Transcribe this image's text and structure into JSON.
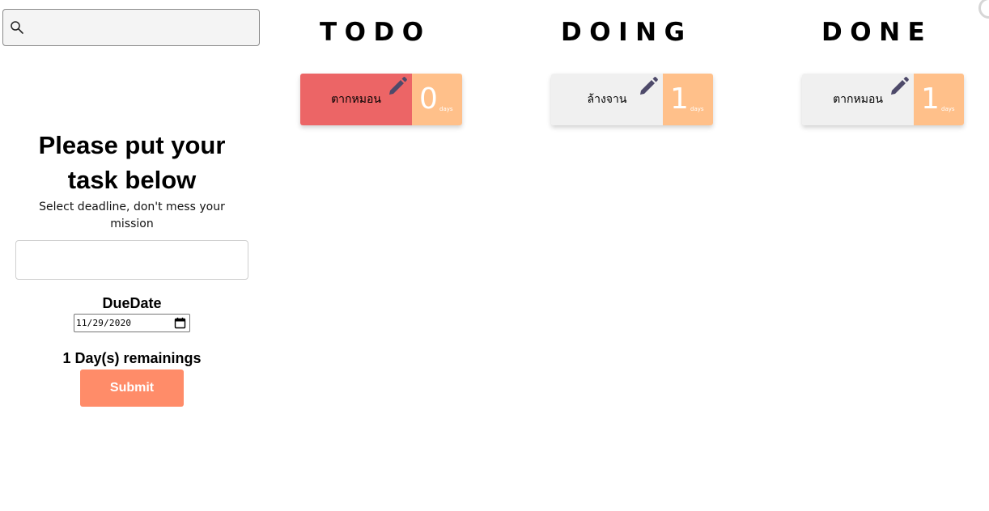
{
  "search": {
    "placeholder": "",
    "value": "",
    "icon": "search-icon"
  },
  "form": {
    "title_line1": "Please put your",
    "title_line2": "task below",
    "subtitle": "Select deadline, don't mess your mission",
    "task_input_value": "",
    "due_label": "DueDate",
    "due_date_display": "11/29/2020",
    "remaining_text": "1 Day(s) remainings",
    "submit_label": "Submit"
  },
  "columns": [
    {
      "title": "TODO",
      "cards": [
        {
          "text": "ตากหมอน",
          "days": "0",
          "unit": "days",
          "status": "overdue"
        }
      ]
    },
    {
      "title": "DOING",
      "cards": [
        {
          "text": "ล้างจาน",
          "days": "1",
          "unit": "days",
          "status": "normal"
        }
      ]
    },
    {
      "title": "DONE",
      "cards": [
        {
          "text": "ตากหมอน",
          "days": "1",
          "unit": "days",
          "status": "normal"
        }
      ]
    }
  ],
  "colors": {
    "overdue_card": "#ec6566",
    "normal_card": "#f0f0f0",
    "days_badge": "#ffc08a",
    "submit_button": "#ff8c69",
    "edit_icon": "#4e4a6a"
  }
}
